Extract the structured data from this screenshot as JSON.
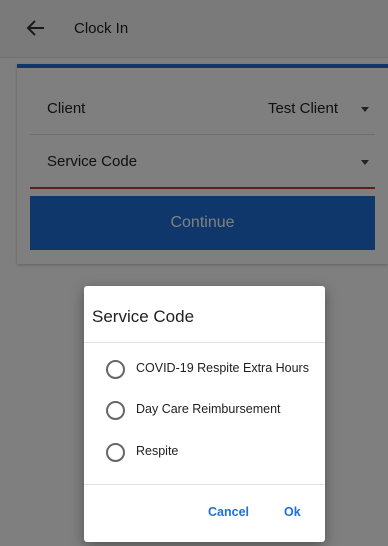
{
  "app_bar": {
    "title": "Clock In",
    "back_icon": "arrow-left-icon"
  },
  "form": {
    "client_label": "Client",
    "client_value": "Test Client",
    "service_code_label": "Service Code",
    "service_code_value": "",
    "continue_label": "Continue"
  },
  "dialog": {
    "title": "Service Code",
    "options": [
      {
        "label": "COVID-19 Respite Extra Hours",
        "selected": false
      },
      {
        "label": "Day Care Reimbursement",
        "selected": false
      },
      {
        "label": "Respite",
        "selected": false
      }
    ],
    "cancel_label": "Cancel",
    "ok_label": "Ok"
  },
  "colors": {
    "accent": "#1e6fd9",
    "error_underline": "#c0392b"
  }
}
